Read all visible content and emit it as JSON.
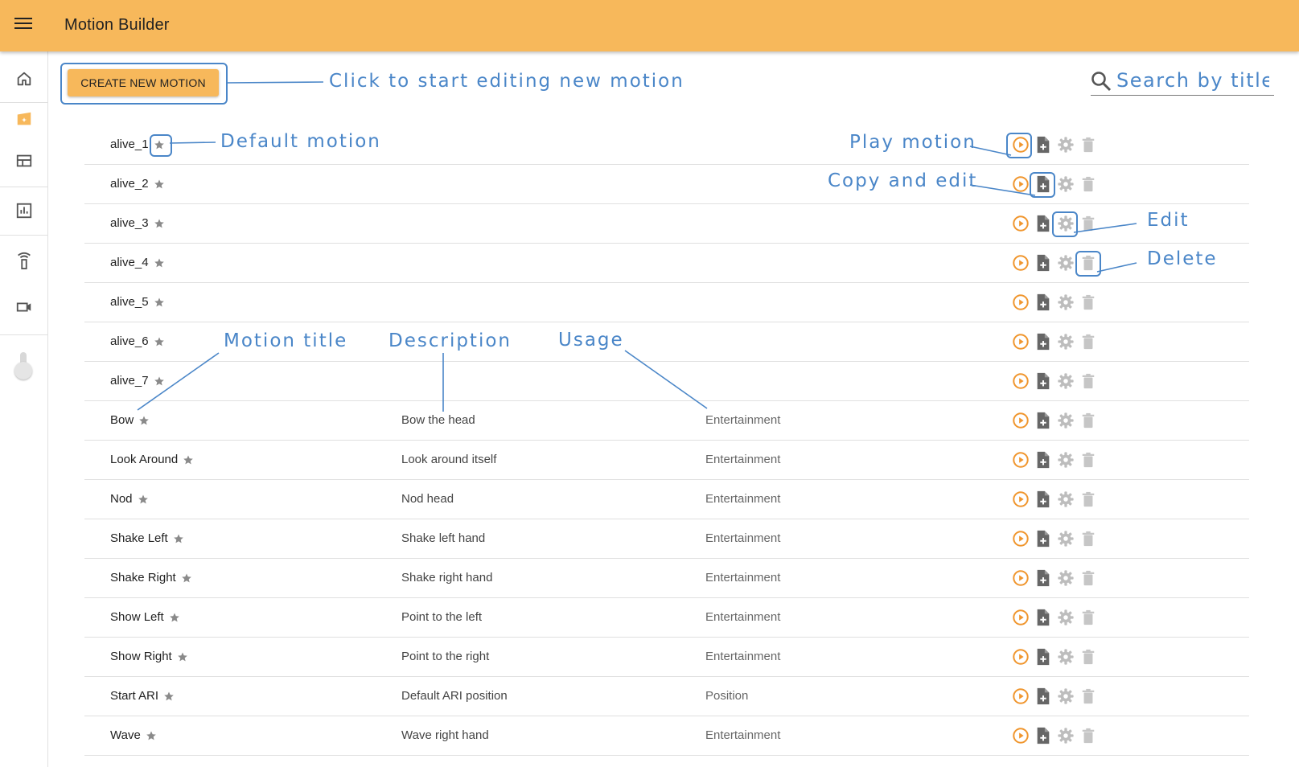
{
  "app": {
    "title": "Motion Builder"
  },
  "toolbar": {
    "create_label": "CREATE NEW MOTION"
  },
  "search": {
    "placeholder": "Search by title"
  },
  "sidebar": {
    "items": [
      "home-icon",
      "motion-icon",
      "dashboard-icon",
      "analytics-icon",
      "remote-icon",
      "video-icon"
    ]
  },
  "annotations": {
    "create": "Click to start editing new motion",
    "default_motion": "Default motion",
    "play": "Play motion",
    "copy_edit": "Copy and edit",
    "edit": "Edit",
    "delete": "Delete",
    "motion_title": "Motion title",
    "description": "Description",
    "usage": "Usage"
  },
  "colors": {
    "accent": "#f7b85b",
    "play": "#f0962e",
    "annotation": "#4a86c8"
  },
  "motions": [
    {
      "title": "alive_1",
      "description": "",
      "usage": ""
    },
    {
      "title": "alive_2",
      "description": "",
      "usage": ""
    },
    {
      "title": "alive_3",
      "description": "",
      "usage": ""
    },
    {
      "title": "alive_4",
      "description": "",
      "usage": ""
    },
    {
      "title": "alive_5",
      "description": "",
      "usage": ""
    },
    {
      "title": "alive_6",
      "description": "",
      "usage": ""
    },
    {
      "title": "alive_7",
      "description": "",
      "usage": ""
    },
    {
      "title": "Bow",
      "description": "Bow the head",
      "usage": "Entertainment"
    },
    {
      "title": "Look Around",
      "description": "Look around itself",
      "usage": "Entertainment"
    },
    {
      "title": "Nod",
      "description": "Nod head",
      "usage": "Entertainment"
    },
    {
      "title": "Shake Left",
      "description": "Shake left hand",
      "usage": "Entertainment"
    },
    {
      "title": "Shake Right",
      "description": "Shake right hand",
      "usage": "Entertainment"
    },
    {
      "title": "Show Left",
      "description": "Point to the left",
      "usage": "Entertainment"
    },
    {
      "title": "Show Right",
      "description": "Point to the right",
      "usage": "Entertainment"
    },
    {
      "title": "Start ARI",
      "description": "Default ARI position",
      "usage": "Position"
    },
    {
      "title": "Wave",
      "description": "Wave right hand",
      "usage": "Entertainment"
    }
  ]
}
